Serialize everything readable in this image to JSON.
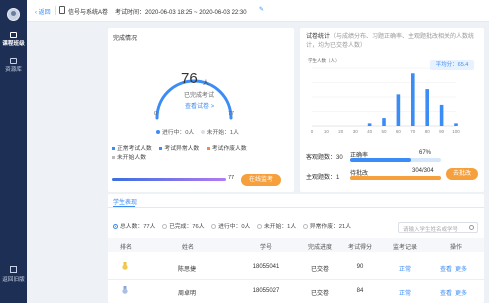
{
  "sidebar": {
    "items": [
      {
        "label": "课程班级",
        "active": true
      },
      {
        "label": "资源库",
        "active": false
      }
    ],
    "footer_label": "返回旧版"
  },
  "topbar": {
    "back_label": "返回",
    "exam_title": "信号与系统A卷",
    "exam_time": "考试时间：2020-06-03 18:25 ~ 2020-06-03 22:30",
    "edit_icon": "✎"
  },
  "completion": {
    "title": "完成情况",
    "count": "76",
    "unit": "人",
    "status_text": "已完成考试",
    "view_exam_label": "查看试卷 >",
    "min": "0",
    "max": "77",
    "in_progress_label": "进行中：0人",
    "not_started_label": "未开始：1人",
    "legend": [
      "正常考试人数",
      "考试异常人数",
      "考试作废人数",
      "未开始人数"
    ],
    "progress_fraction": 0.99,
    "progress_end": "77",
    "monitor_button": "在线监考",
    "colors": {
      "ring": "#3b8cf5",
      "progress_start": "#3a6fe0",
      "progress_end": "#b27bf0",
      "button": "#f5a03c"
    },
    "legend_colors": [
      "#3b8cf5",
      "#3b8cf5",
      "#f08a4b",
      "#bbbbbb"
    ]
  },
  "stats": {
    "title": "试卷统计",
    "note": "（与成绩分布、习题正确率、主观题批改相关的人数统计，均为已交卷人数）",
    "y_axis_label": "学生人数（人）",
    "avg_label": "平均分：65.4",
    "objective_label": "客观题数：30",
    "accuracy_label": "正确率",
    "accuracy_value": "67%",
    "accuracy_fraction": 0.67,
    "subjective_label": "主观题数：1",
    "grading_label": "待批改",
    "grading_value": "304/304",
    "grading_fraction": 1.0,
    "grade_button": "去批改",
    "colors": {
      "bar": "#3b8cf5",
      "track": "#d6e7fc",
      "accuracy": "#3b8cf5",
      "grading": "#f5a03c"
    }
  },
  "chart_data": {
    "type": "bar",
    "ylabel": "学生人数（人）",
    "categories": [
      "0",
      "10",
      "20",
      "30",
      "40",
      "50",
      "60",
      "70",
      "80",
      "90",
      "100"
    ],
    "values": [
      0,
      0,
      0,
      0,
      1,
      3,
      12,
      20,
      14,
      8,
      1
    ],
    "ylim": [
      0,
      22
    ],
    "grid": true,
    "legend": false
  },
  "students": {
    "tab_label": "学生表现",
    "filters": [
      {
        "label": "总人数：77人",
        "selected": true
      },
      {
        "label": "已完成：76人",
        "selected": false
      },
      {
        "label": "进行中：0人",
        "selected": false
      },
      {
        "label": "未开始：1人",
        "selected": false
      },
      {
        "label": "异常作废：21人",
        "selected": false
      }
    ],
    "search_placeholder": "请输入学生姓名或学号",
    "columns": [
      "排名",
      "姓名",
      "学号",
      "完成进度",
      "考试得分",
      "监考记录",
      "操作"
    ],
    "rows": [
      {
        "rank_icon": "gold-medal-icon",
        "name": "陈思捷",
        "id": "18055041",
        "progress": "已交卷",
        "score": "90",
        "record": "正常",
        "action_view": "查看",
        "action_more": "更多"
      },
      {
        "rank_icon": "silver-medal-icon",
        "name": "周卓明",
        "id": "18055027",
        "progress": "已交卷",
        "score": "84",
        "record": "正常",
        "action_view": "查看",
        "action_more": "更多"
      }
    ]
  }
}
